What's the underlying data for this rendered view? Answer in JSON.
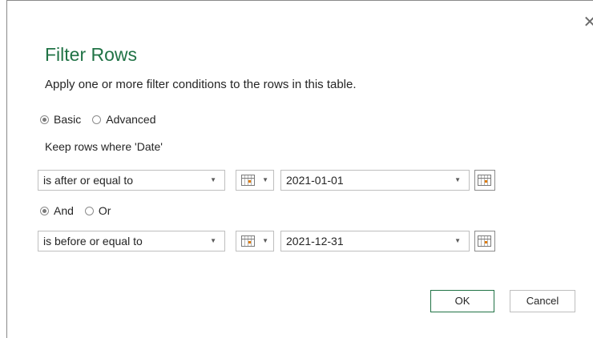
{
  "dialog": {
    "title": "Filter Rows",
    "description": "Apply one or more filter conditions to the rows in this table.",
    "close_glyph": "✕"
  },
  "mode": {
    "options": [
      {
        "label": "Basic",
        "checked": true
      },
      {
        "label": "Advanced",
        "checked": false
      }
    ]
  },
  "keep_label": "Keep rows where 'Date'",
  "conditions": [
    {
      "operator": "is after or equal to",
      "value": "2021-01-01"
    },
    {
      "operator": "is before or equal to",
      "value": "2021-12-31"
    }
  ],
  "logic": {
    "options": [
      {
        "label": "And",
        "checked": true
      },
      {
        "label": "Or",
        "checked": false
      }
    ]
  },
  "buttons": {
    "ok": "OK",
    "cancel": "Cancel"
  },
  "icons": {
    "close": "close-icon",
    "calendar": "calendar-icon",
    "chevron": "chevron-down-icon",
    "chevron_glyph": "▼"
  },
  "colors": {
    "accent": "#217346",
    "title": "#217346"
  }
}
